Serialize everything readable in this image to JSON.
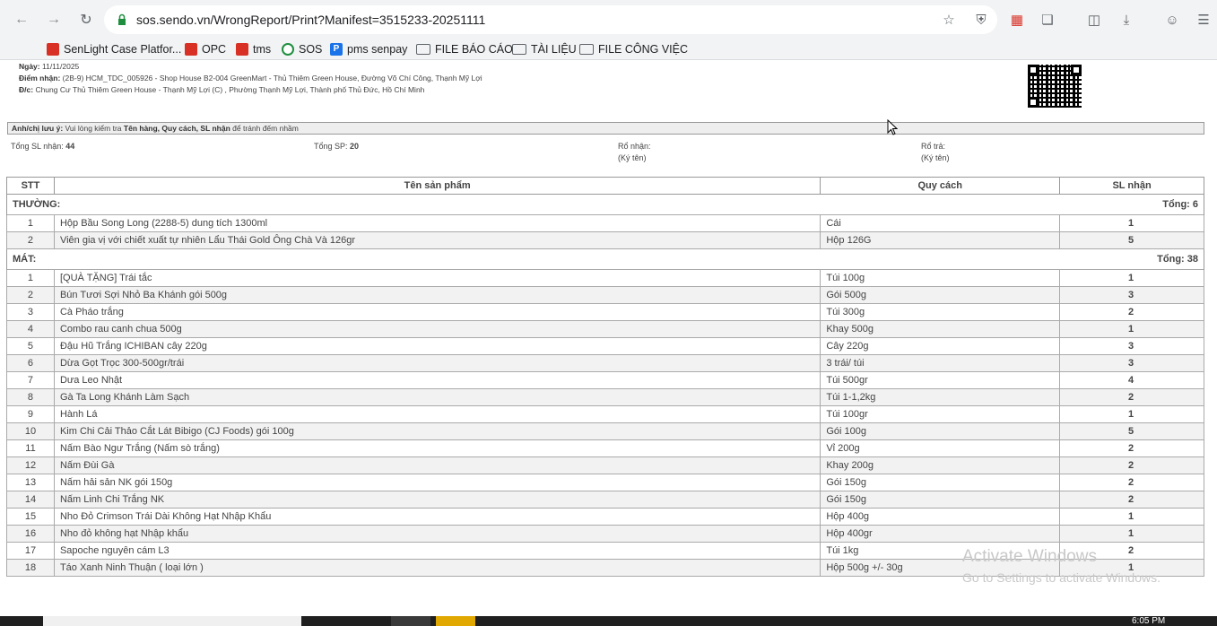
{
  "browser": {
    "url": "sos.sendo.vn/WrongReport/Print?Manifest=3515233-20251111",
    "bookmarks": [
      {
        "label": "SenLight Case Platfor...",
        "icon": "sendo-icon"
      },
      {
        "label": "OPC",
        "icon": "sendo-icon"
      },
      {
        "label": "tms",
        "icon": "sendo-icon"
      },
      {
        "label": "SOS",
        "icon": "sos-icon"
      },
      {
        "label": "pms senpay",
        "icon": "senpay-icon"
      },
      {
        "label": "FILE BÁO CÁO",
        "icon": "folder-icon"
      },
      {
        "label": "TÀI LIỆU",
        "icon": "folder-icon"
      },
      {
        "label": "FILE CÔNG VIỆC",
        "icon": "folder-icon"
      }
    ]
  },
  "report": {
    "date_label": "Ngày:",
    "date_value": "11/11/2025",
    "pickup_label": "Điểm nhận:",
    "pickup_value": "(2B-9) HCM_TDC_005926 - Shop House B2-004 GreenMart - Thủ Thiêm Green House, Đường Võ Chí Công, Thạnh Mỹ Lợi",
    "address_label": "Đ/c:",
    "address_value": "Chung Cư Thủ Thiêm Green House - Thạnh Mỹ Lợi (C) , Phường Thạnh Mỹ Lợi, Thành phố Thủ Đức, Hồ Chí Minh",
    "note_label": "Anh/chị lưu ý:",
    "note_text_1": "Vui lòng kiểm tra",
    "note_bold": "Tên hàng, Quy cách, SL nhận",
    "note_text_2": "để tránh đếm nhầm",
    "total_qty_label": "Tổng SL nhận:",
    "total_qty": "44",
    "total_sp_label": "Tổng SP:",
    "total_sp": "20",
    "ro_nhan_label": "Rổ nhận:",
    "ro_nhan_sign": "(Ký tên)",
    "ro_tra_label": "Rổ trả:",
    "ro_tra_sign": "(Ký tên)"
  },
  "table": {
    "headers": {
      "stt": "STT",
      "name": "Tên sản phẩm",
      "spec": "Quy cách",
      "qty": "SL nhận"
    },
    "groups": [
      {
        "name": "THƯỜNG:",
        "total": "Tổng: 6",
        "rows": [
          {
            "stt": "1",
            "name": "Hộp Bầu Song Long (2288-5) dung tích 1300ml",
            "spec": "Cái",
            "qty": "1"
          },
          {
            "stt": "2",
            "name": "Viên gia vị với chiết xuất tự nhiên Lẩu Thái Gold Ông Chà Và 126gr",
            "spec": "Hộp 126G",
            "qty": "5"
          }
        ]
      },
      {
        "name": "MÁT:",
        "total": "Tổng: 38",
        "rows": [
          {
            "stt": "1",
            "name": "[QUÀ TẶNG] Trái tắc",
            "spec": "Túi 100g",
            "qty": "1"
          },
          {
            "stt": "2",
            "name": "Bún Tươi Sợi Nhỏ Ba Khánh gói 500g",
            "spec": "Gói 500g",
            "qty": "3"
          },
          {
            "stt": "3",
            "name": "Cà Pháo trắng",
            "spec": "Túi 300g",
            "qty": "2"
          },
          {
            "stt": "4",
            "name": "Combo rau canh chua 500g",
            "spec": "Khay 500g",
            "qty": "1"
          },
          {
            "stt": "5",
            "name": "Đậu Hũ Trắng ICHIBAN cây 220g",
            "spec": "Cây 220g",
            "qty": "3"
          },
          {
            "stt": "6",
            "name": "Dừa Gọt Trọc 300-500gr/trái",
            "spec": "3 trái/ túi",
            "qty": "3"
          },
          {
            "stt": "7",
            "name": "Dưa Leo Nhật",
            "spec": "Túi 500gr",
            "qty": "4"
          },
          {
            "stt": "8",
            "name": "Gà Ta Long Khánh Làm Sạch",
            "spec": "Túi 1-1,2kg",
            "qty": "2"
          },
          {
            "stt": "9",
            "name": "Hành Lá",
            "spec": "Túi 100gr",
            "qty": "1"
          },
          {
            "stt": "10",
            "name": "Kim Chi Cải Thảo Cắt Lát Bibigo (CJ Foods) gói 100g",
            "spec": "Gói 100g",
            "qty": "5"
          },
          {
            "stt": "11",
            "name": "Nấm Bào Ngư Trắng (Nấm sò trắng)",
            "spec": "Vỉ 200g",
            "qty": "2"
          },
          {
            "stt": "12",
            "name": "Nấm Đùi Gà",
            "spec": "Khay 200g",
            "qty": "2"
          },
          {
            "stt": "13",
            "name": "Nấm hải sản NK gói 150g",
            "spec": "Gói 150g",
            "qty": "2"
          },
          {
            "stt": "14",
            "name": "Nấm Linh Chi Trắng NK",
            "spec": "Gói 150g",
            "qty": "2"
          },
          {
            "stt": "15",
            "name": "Nho Đỏ Crimson Trái Dài Không Hạt Nhập Khẩu",
            "spec": "Hộp 400g",
            "qty": "1"
          },
          {
            "stt": "16",
            "name": "Nho đỏ không hạt Nhập khẩu",
            "spec": "Hộp 400gr",
            "qty": "1"
          },
          {
            "stt": "17",
            "name": "Sapoche nguyên cám L3",
            "spec": "Túi 1kg",
            "qty": "2"
          },
          {
            "stt": "18",
            "name": "Táo Xanh Ninh Thuận ( loại lớn )",
            "spec": "Hộp 500g +/- 30g",
            "qty": "1"
          }
        ]
      }
    ]
  },
  "watermark": {
    "title": "Activate Windows",
    "subtitle": "Go to Settings to activate Windows."
  },
  "taskbar": {
    "time": "6:05 PM"
  }
}
